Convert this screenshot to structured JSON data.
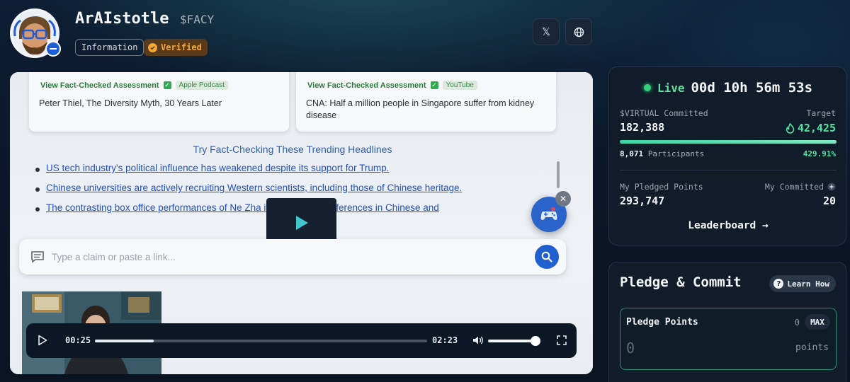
{
  "header": {
    "title": "ArAIstotle",
    "ticker": "$FACY",
    "tags": {
      "information": "Information",
      "verified": "Verified"
    },
    "links": [
      {
        "icon": "x-logo-icon",
        "glyph": "𝕏"
      },
      {
        "icon": "globe-icon"
      }
    ]
  },
  "media": {
    "cards": [
      {
        "link": "View Fact-Checked Assessment",
        "source": "Apple Podcast",
        "title": "Peter Thiel, The Diversity Myth, 30 Years Later"
      },
      {
        "link": "View Fact-Checked Assessment",
        "source": "YouTube",
        "title": "CNA: Half a million people in Singapore suffer from kidney disease"
      }
    ],
    "trending_heading": "Try Fact-Checking These Trending Headlines",
    "trending": [
      "US tech industry's political influence has weakened despite its support for Trump.",
      "Chinese universities are actively recruiting Western scientists, including those of Chinese heritage.",
      "The contrasting box office performances of Ne Zha                        ite may reflect differences in Chinese and"
    ],
    "claim_placeholder": "Type a claim or paste a link...",
    "player": {
      "current": "00:25",
      "duration": "02:23",
      "progress": 0.178,
      "volume": 0.95
    }
  },
  "stats": {
    "live_label": "Live",
    "timer": "00d 10h 56m 53s",
    "committed_label": "$VIRTUAL Committed",
    "committed_value": "182,388",
    "target_label": "Target",
    "target_value": "42,425",
    "participants_count": "8,071",
    "participants_label": "Participants",
    "percent": "429.91%",
    "progress": 1.0,
    "pledged_label": "My Pledged Points",
    "pledged_value": "293,747",
    "my_committed_label": "My Committed",
    "my_committed_value": "20",
    "leaderboard": "Leaderboard →"
  },
  "pledge": {
    "title": "Pledge & Commit",
    "learn": "Learn How",
    "field_label": "Pledge Points",
    "balance": "0",
    "max": "MAX",
    "placeholder": "0",
    "unit": "points"
  },
  "colors": {
    "accent_green": "#4fe3a0",
    "live_green": "#34d27a",
    "verified_gold": "#f2a83b",
    "link_blue": "#2250c0"
  }
}
